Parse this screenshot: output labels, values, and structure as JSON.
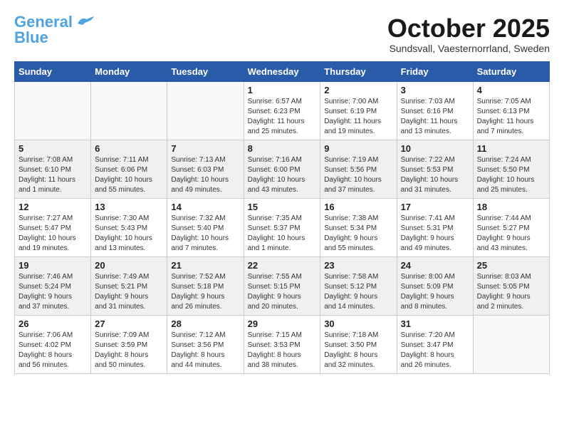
{
  "header": {
    "logo_general": "General",
    "logo_blue": "Blue",
    "month_title": "October 2025",
    "location": "Sundsvall, Vaesternorrland, Sweden"
  },
  "days_of_week": [
    "Sunday",
    "Monday",
    "Tuesday",
    "Wednesday",
    "Thursday",
    "Friday",
    "Saturday"
  ],
  "weeks": [
    [
      {
        "day": "",
        "info": ""
      },
      {
        "day": "",
        "info": ""
      },
      {
        "day": "",
        "info": ""
      },
      {
        "day": "1",
        "info": "Sunrise: 6:57 AM\nSunset: 6:23 PM\nDaylight: 11 hours\nand 25 minutes."
      },
      {
        "day": "2",
        "info": "Sunrise: 7:00 AM\nSunset: 6:19 PM\nDaylight: 11 hours\nand 19 minutes."
      },
      {
        "day": "3",
        "info": "Sunrise: 7:03 AM\nSunset: 6:16 PM\nDaylight: 11 hours\nand 13 minutes."
      },
      {
        "day": "4",
        "info": "Sunrise: 7:05 AM\nSunset: 6:13 PM\nDaylight: 11 hours\nand 7 minutes."
      }
    ],
    [
      {
        "day": "5",
        "info": "Sunrise: 7:08 AM\nSunset: 6:10 PM\nDaylight: 11 hours\nand 1 minute."
      },
      {
        "day": "6",
        "info": "Sunrise: 7:11 AM\nSunset: 6:06 PM\nDaylight: 10 hours\nand 55 minutes."
      },
      {
        "day": "7",
        "info": "Sunrise: 7:13 AM\nSunset: 6:03 PM\nDaylight: 10 hours\nand 49 minutes."
      },
      {
        "day": "8",
        "info": "Sunrise: 7:16 AM\nSunset: 6:00 PM\nDaylight: 10 hours\nand 43 minutes."
      },
      {
        "day": "9",
        "info": "Sunrise: 7:19 AM\nSunset: 5:56 PM\nDaylight: 10 hours\nand 37 minutes."
      },
      {
        "day": "10",
        "info": "Sunrise: 7:22 AM\nSunset: 5:53 PM\nDaylight: 10 hours\nand 31 minutes."
      },
      {
        "day": "11",
        "info": "Sunrise: 7:24 AM\nSunset: 5:50 PM\nDaylight: 10 hours\nand 25 minutes."
      }
    ],
    [
      {
        "day": "12",
        "info": "Sunrise: 7:27 AM\nSunset: 5:47 PM\nDaylight: 10 hours\nand 19 minutes."
      },
      {
        "day": "13",
        "info": "Sunrise: 7:30 AM\nSunset: 5:43 PM\nDaylight: 10 hours\nand 13 minutes."
      },
      {
        "day": "14",
        "info": "Sunrise: 7:32 AM\nSunset: 5:40 PM\nDaylight: 10 hours\nand 7 minutes."
      },
      {
        "day": "15",
        "info": "Sunrise: 7:35 AM\nSunset: 5:37 PM\nDaylight: 10 hours\nand 1 minute."
      },
      {
        "day": "16",
        "info": "Sunrise: 7:38 AM\nSunset: 5:34 PM\nDaylight: 9 hours\nand 55 minutes."
      },
      {
        "day": "17",
        "info": "Sunrise: 7:41 AM\nSunset: 5:31 PM\nDaylight: 9 hours\nand 49 minutes."
      },
      {
        "day": "18",
        "info": "Sunrise: 7:44 AM\nSunset: 5:27 PM\nDaylight: 9 hours\nand 43 minutes."
      }
    ],
    [
      {
        "day": "19",
        "info": "Sunrise: 7:46 AM\nSunset: 5:24 PM\nDaylight: 9 hours\nand 37 minutes."
      },
      {
        "day": "20",
        "info": "Sunrise: 7:49 AM\nSunset: 5:21 PM\nDaylight: 9 hours\nand 31 minutes."
      },
      {
        "day": "21",
        "info": "Sunrise: 7:52 AM\nSunset: 5:18 PM\nDaylight: 9 hours\nand 26 minutes."
      },
      {
        "day": "22",
        "info": "Sunrise: 7:55 AM\nSunset: 5:15 PM\nDaylight: 9 hours\nand 20 minutes."
      },
      {
        "day": "23",
        "info": "Sunrise: 7:58 AM\nSunset: 5:12 PM\nDaylight: 9 hours\nand 14 minutes."
      },
      {
        "day": "24",
        "info": "Sunrise: 8:00 AM\nSunset: 5:09 PM\nDaylight: 9 hours\nand 8 minutes."
      },
      {
        "day": "25",
        "info": "Sunrise: 8:03 AM\nSunset: 5:05 PM\nDaylight: 9 hours\nand 2 minutes."
      }
    ],
    [
      {
        "day": "26",
        "info": "Sunrise: 7:06 AM\nSunset: 4:02 PM\nDaylight: 8 hours\nand 56 minutes."
      },
      {
        "day": "27",
        "info": "Sunrise: 7:09 AM\nSunset: 3:59 PM\nDaylight: 8 hours\nand 50 minutes."
      },
      {
        "day": "28",
        "info": "Sunrise: 7:12 AM\nSunset: 3:56 PM\nDaylight: 8 hours\nand 44 minutes."
      },
      {
        "day": "29",
        "info": "Sunrise: 7:15 AM\nSunset: 3:53 PM\nDaylight: 8 hours\nand 38 minutes."
      },
      {
        "day": "30",
        "info": "Sunrise: 7:18 AM\nSunset: 3:50 PM\nDaylight: 8 hours\nand 32 minutes."
      },
      {
        "day": "31",
        "info": "Sunrise: 7:20 AM\nSunset: 3:47 PM\nDaylight: 8 hours\nand 26 minutes."
      },
      {
        "day": "",
        "info": ""
      }
    ]
  ]
}
